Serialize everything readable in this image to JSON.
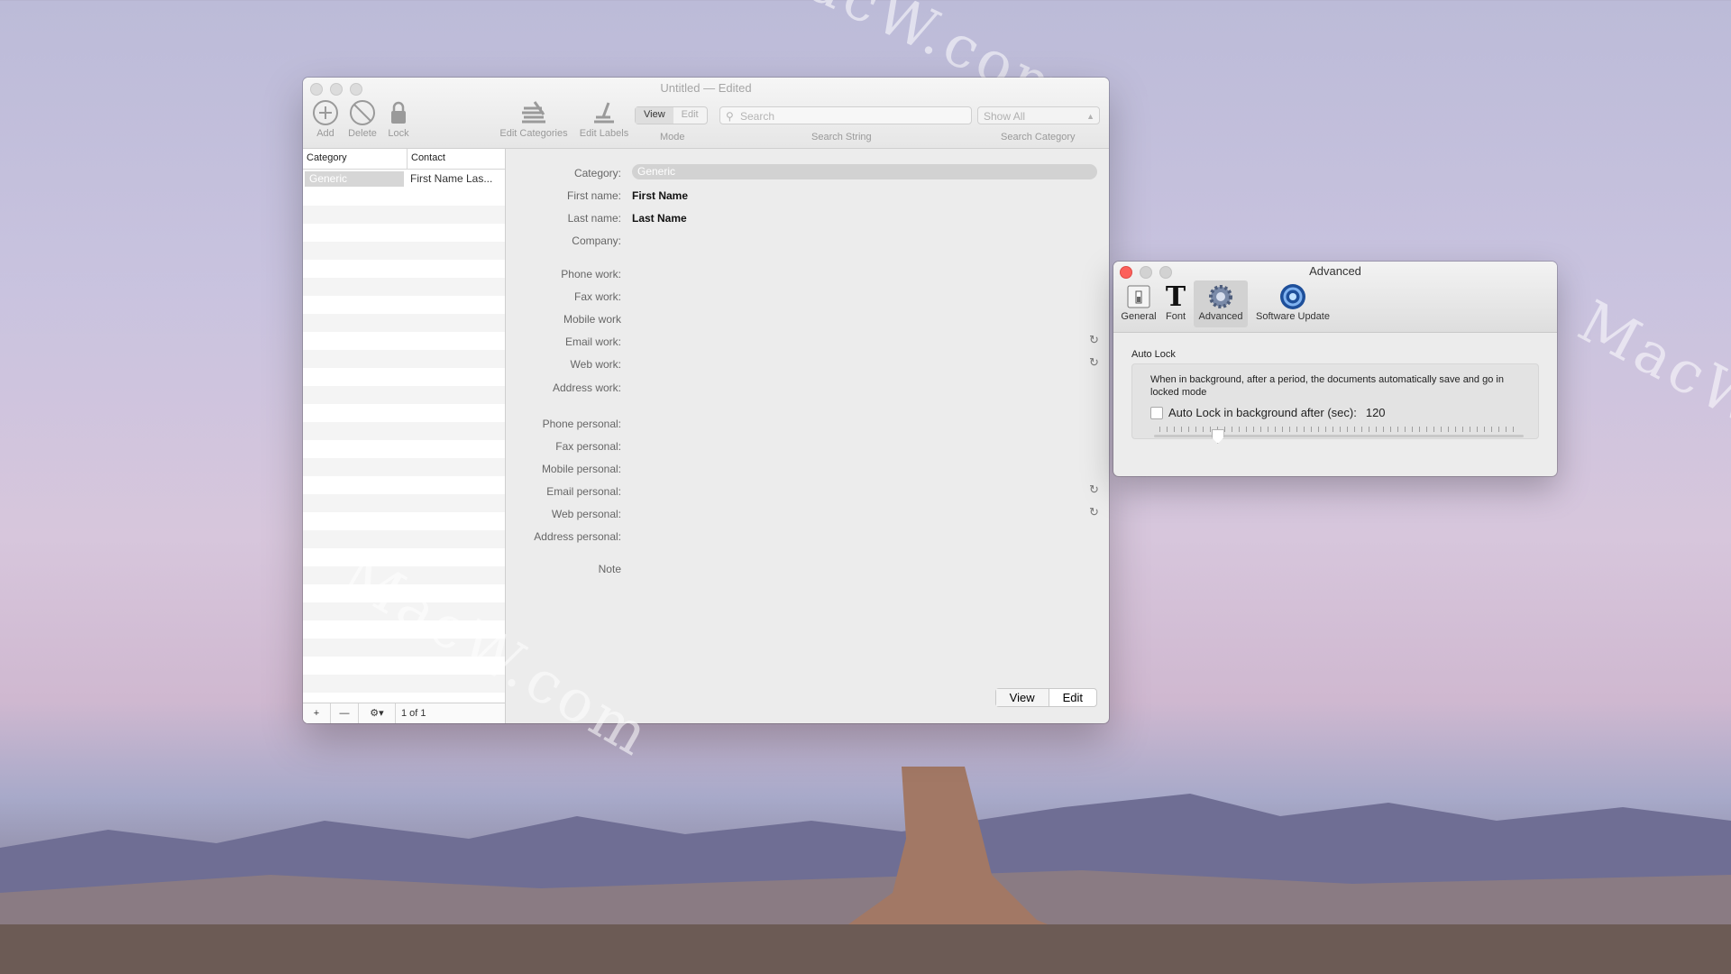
{
  "main_window": {
    "title": "Untitled — Edited",
    "toolbar": {
      "add_label": "Add",
      "delete_label": "Delete",
      "lock_label": "Lock",
      "edit_categories_label": "Edit Categories",
      "edit_labels_label": "Edit Labels",
      "mode": {
        "view": "View",
        "edit": "Edit",
        "label": "Mode",
        "selected": "View"
      },
      "search": {
        "placeholder": "Search",
        "label": "Search String"
      },
      "category_select": {
        "value": "Show All",
        "label": "Search Category"
      }
    },
    "sidebar": {
      "columns": [
        "Category",
        "Contact"
      ],
      "rows": [
        {
          "category": "Generic",
          "contact": "First Name Las..."
        }
      ],
      "footer": {
        "add": "+",
        "remove": "—",
        "page": "1 of 1"
      }
    },
    "detail": {
      "category_label": "Category:",
      "category_value": "Generic",
      "fields": [
        {
          "label": "First name:",
          "value": "First Name"
        },
        {
          "label": "Last name:",
          "value": "Last Name"
        },
        {
          "label": "Company:",
          "value": ""
        },
        {
          "label": "Phone work:",
          "value": ""
        },
        {
          "label": "Fax work:",
          "value": ""
        },
        {
          "label": "Mobile work",
          "value": ""
        },
        {
          "label": "Email work:",
          "value": ""
        },
        {
          "label": "Web work:",
          "value": ""
        },
        {
          "label": "Address work:",
          "value": ""
        },
        {
          "label": "Phone personal:",
          "value": ""
        },
        {
          "label": "Fax personal:",
          "value": ""
        },
        {
          "label": "Mobile personal:",
          "value": ""
        },
        {
          "label": "Email personal:",
          "value": ""
        },
        {
          "label": "Web personal:",
          "value": ""
        },
        {
          "label": "Address personal:",
          "value": ""
        },
        {
          "label": "Note",
          "value": ""
        }
      ],
      "view_button": "View",
      "edit_button": "Edit"
    }
  },
  "prefs_window": {
    "title": "Advanced",
    "tabs": [
      {
        "label": "General",
        "icon": "switch-icon"
      },
      {
        "label": "Font",
        "icon": "font-icon"
      },
      {
        "label": "Advanced",
        "icon": "gear-icon",
        "selected": true
      },
      {
        "label": "Software Update",
        "icon": "update-icon"
      }
    ],
    "auto_lock": {
      "group_title": "Auto Lock",
      "description": "When in background, after a period, the documents automatically save and go in locked mode",
      "checkbox_label": "Auto Lock in background after (sec):",
      "checkbox_checked": false,
      "seconds_value": "120",
      "slider_fraction": 0.17
    }
  },
  "watermarks": [
    "MacW.com",
    "MacW.com",
    "MacW.c"
  ]
}
